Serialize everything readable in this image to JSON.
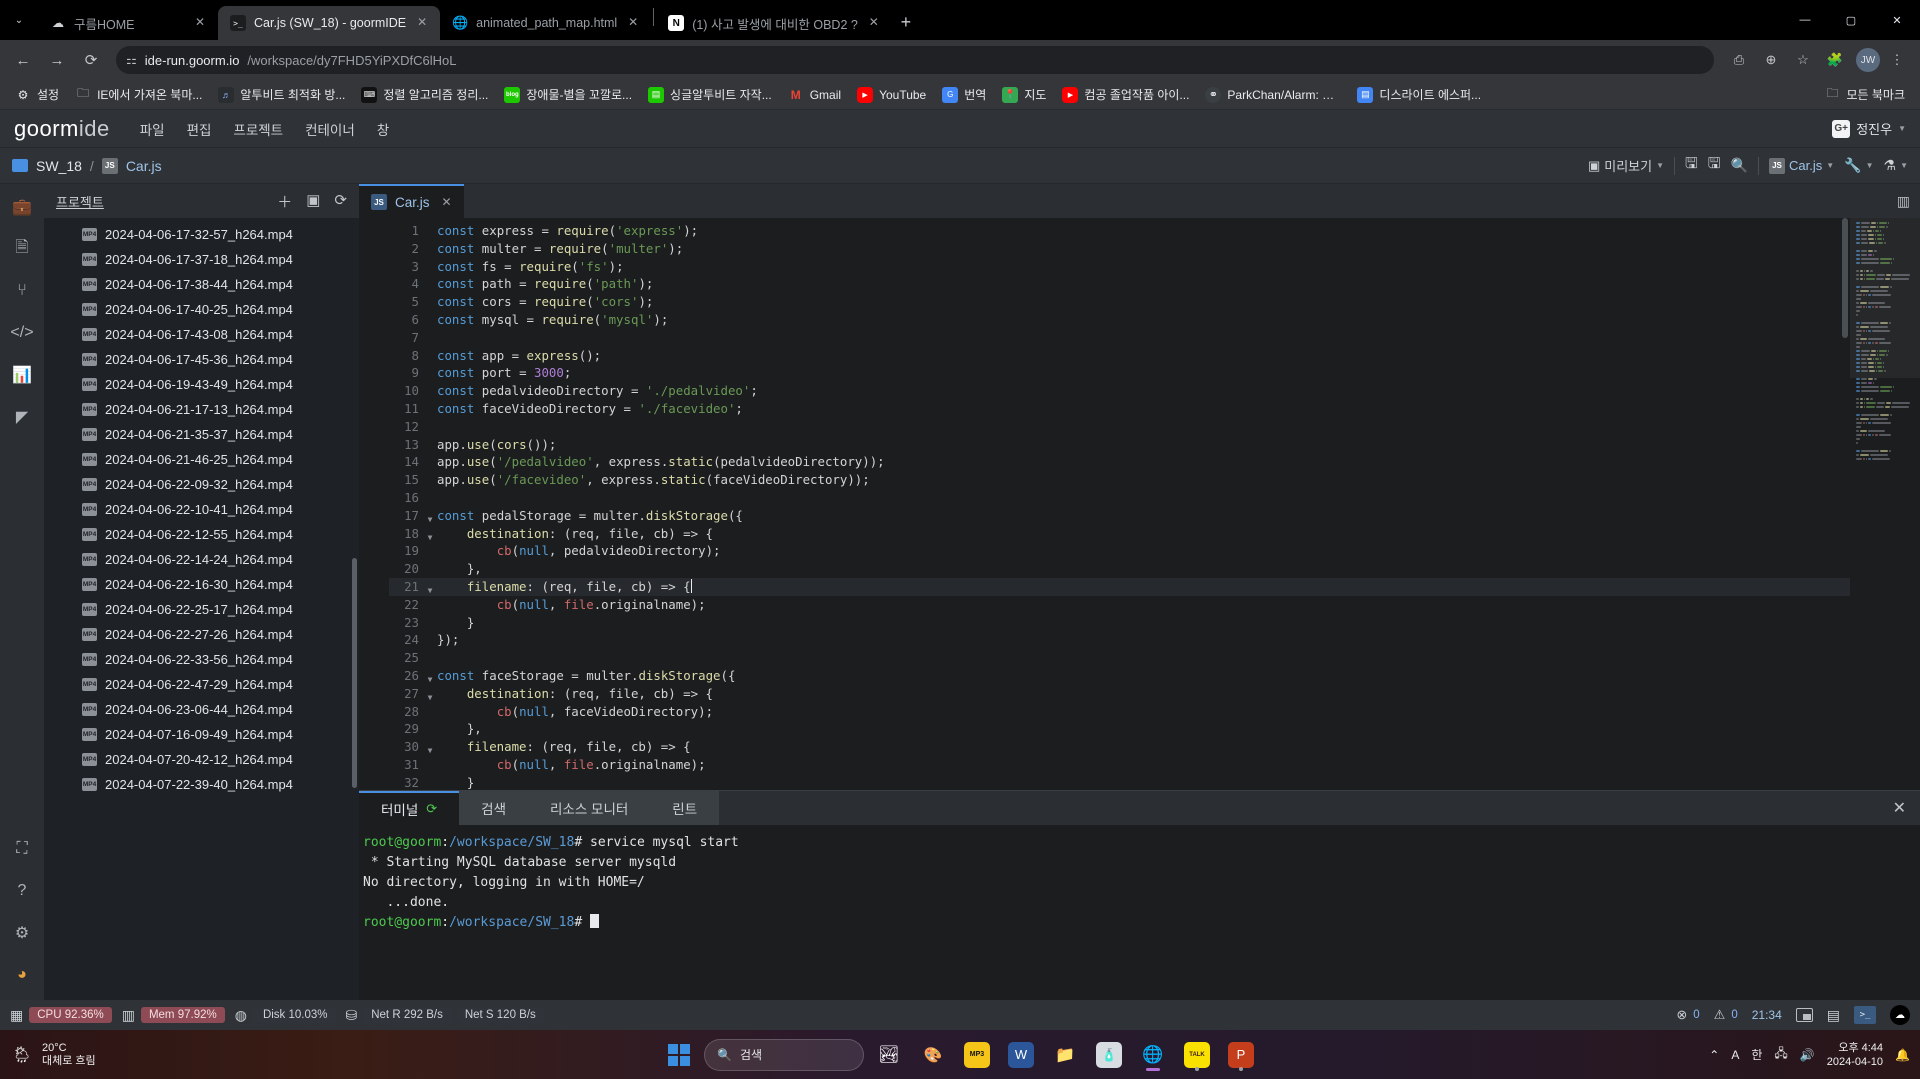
{
  "browser": {
    "tabs": [
      {
        "title": "구름HOME",
        "icon": "cloud-icon",
        "active": false
      },
      {
        "title": "Car.js (SW_18) - goormIDE",
        "icon": "terminal-icon",
        "active": true
      },
      {
        "title": "animated_path_map.html",
        "icon": "globe-icon",
        "active": false
      },
      {
        "title": "(1) 사고 발생에 대비한 OBD2 ?",
        "icon": "notion-icon",
        "active": false
      }
    ],
    "new_tab_label": "+",
    "nav": {
      "back": "←",
      "forward": "→",
      "reload": "⟳"
    },
    "address": {
      "host": "ide-run.goorm.io",
      "path": "/workspace/dy7FHD5YiPXDfC6lHoL"
    },
    "window_controls": {
      "minimize": "—",
      "maximize": "▢",
      "close": "✕"
    },
    "bookmarks": [
      {
        "label": "설정",
        "icon": "gear-icon"
      },
      {
        "label": "IE에서 가져온 북마...",
        "icon": "folder-icon"
      },
      {
        "label": "알투비트 최적화 방...",
        "icon": "music-icon"
      },
      {
        "label": "정렬 알고리즘 정리...",
        "icon": "keyboard-icon"
      },
      {
        "label": "장애물-별을 꼬깔로...",
        "icon": "blog-icon"
      },
      {
        "label": "싱글알투비트 자작...",
        "icon": "naver-icon"
      },
      {
        "label": "Gmail",
        "icon": "gmail-icon"
      },
      {
        "label": "YouTube",
        "icon": "youtube-icon"
      },
      {
        "label": "번역",
        "icon": "translate-icon"
      },
      {
        "label": "지도",
        "icon": "maps-icon"
      },
      {
        "label": "컴공 졸업작품 아이...",
        "icon": "youtube-icon"
      },
      {
        "label": "ParkChan/Alarm: 알...",
        "icon": "github-icon"
      },
      {
        "label": "디스라이트 에스퍼...",
        "icon": "doc-icon"
      }
    ],
    "all_bookmarks_label": "모든 북마크"
  },
  "ide": {
    "logo_bold": "goorm",
    "logo_dim": "ide",
    "menu": [
      "파일",
      "편집",
      "프로젝트",
      "컨테이너",
      "창"
    ],
    "user": "정진우",
    "breadcrumb": {
      "workspace": "SW_18",
      "separator": "/",
      "file": "Car.js",
      "file_badge": "JS"
    },
    "toolbar": {
      "preview_label": "미리보기",
      "save_title": "저장",
      "save_all_title": "모두 저장",
      "search_title": "검색",
      "run_target": "Car.js",
      "run_badge": "JS",
      "wrench_title": "설정",
      "flask_title": "테스트",
      "layout_title": "레이아웃"
    },
    "activity_icons": [
      "briefcase-icon",
      "document-icon",
      "git-branch-icon",
      "code-icon",
      "chart-icon",
      "extensions-icon"
    ],
    "activity_bottom_icons": [
      "fullscreen-icon",
      "help-icon",
      "settings-icon",
      "user-icon"
    ],
    "panel": {
      "title": "프로젝트",
      "actions": [
        "plus-icon",
        "collapse-icon",
        "refresh-icon"
      ],
      "files": [
        "2024-04-06-17-32-57_h264.mp4",
        "2024-04-06-17-37-18_h264.mp4",
        "2024-04-06-17-38-44_h264.mp4",
        "2024-04-06-17-40-25_h264.mp4",
        "2024-04-06-17-43-08_h264.mp4",
        "2024-04-06-17-45-36_h264.mp4",
        "2024-04-06-19-43-49_h264.mp4",
        "2024-04-06-21-17-13_h264.mp4",
        "2024-04-06-21-35-37_h264.mp4",
        "2024-04-06-21-46-25_h264.mp4",
        "2024-04-06-22-09-32_h264.mp4",
        "2024-04-06-22-10-41_h264.mp4",
        "2024-04-06-22-12-55_h264.mp4",
        "2024-04-06-22-14-24_h264.mp4",
        "2024-04-06-22-16-30_h264.mp4",
        "2024-04-06-22-25-17_h264.mp4",
        "2024-04-06-22-27-26_h264.mp4",
        "2024-04-06-22-33-56_h264.mp4",
        "2024-04-06-22-47-29_h264.mp4",
        "2024-04-06-23-06-44_h264.mp4",
        "2024-04-07-16-09-49_h264.mp4",
        "2024-04-07-20-42-12_h264.mp4",
        "2024-04-07-22-39-40_h264.mp4"
      ],
      "file_badge": "MP4"
    },
    "editor": {
      "tab": {
        "badge": "JS",
        "name": "Car.js",
        "close": "✕"
      },
      "cursor_line": 21,
      "lines": [
        {
          "n": 1,
          "fold": false,
          "tokens": [
            [
              "kw",
              "const"
            ],
            [
              "plain",
              " express = "
            ],
            [
              "fn",
              "require"
            ],
            [
              "plain",
              "("
            ],
            [
              "str",
              "'express'"
            ],
            [
              "plain",
              ");"
            ]
          ]
        },
        {
          "n": 2,
          "fold": false,
          "tokens": [
            [
              "kw",
              "const"
            ],
            [
              "plain",
              " multer = "
            ],
            [
              "fn",
              "require"
            ],
            [
              "plain",
              "("
            ],
            [
              "str",
              "'multer'"
            ],
            [
              "plain",
              ");"
            ]
          ]
        },
        {
          "n": 3,
          "fold": false,
          "tokens": [
            [
              "kw",
              "const"
            ],
            [
              "plain",
              " fs = "
            ],
            [
              "fn",
              "require"
            ],
            [
              "plain",
              "("
            ],
            [
              "str",
              "'fs'"
            ],
            [
              "plain",
              ");"
            ]
          ]
        },
        {
          "n": 4,
          "fold": false,
          "tokens": [
            [
              "kw",
              "const"
            ],
            [
              "plain",
              " path = "
            ],
            [
              "fn",
              "require"
            ],
            [
              "plain",
              "("
            ],
            [
              "str",
              "'path'"
            ],
            [
              "plain",
              ");"
            ]
          ]
        },
        {
          "n": 5,
          "fold": false,
          "tokens": [
            [
              "kw",
              "const"
            ],
            [
              "plain",
              " cors = "
            ],
            [
              "fn",
              "require"
            ],
            [
              "plain",
              "("
            ],
            [
              "str",
              "'cors'"
            ],
            [
              "plain",
              ");"
            ]
          ]
        },
        {
          "n": 6,
          "fold": false,
          "tokens": [
            [
              "kw",
              "const"
            ],
            [
              "plain",
              " mysql = "
            ],
            [
              "fn",
              "require"
            ],
            [
              "plain",
              "("
            ],
            [
              "str",
              "'mysql'"
            ],
            [
              "plain",
              ");"
            ]
          ]
        },
        {
          "n": 7,
          "fold": false,
          "tokens": []
        },
        {
          "n": 8,
          "fold": false,
          "tokens": [
            [
              "kw",
              "const"
            ],
            [
              "plain",
              " app = "
            ],
            [
              "fn",
              "express"
            ],
            [
              "plain",
              "();"
            ]
          ]
        },
        {
          "n": 9,
          "fold": false,
          "tokens": [
            [
              "kw",
              "const"
            ],
            [
              "plain",
              " port = "
            ],
            [
              "num",
              "3000"
            ],
            [
              "plain",
              ";"
            ]
          ]
        },
        {
          "n": 10,
          "fold": false,
          "tokens": [
            [
              "kw",
              "const"
            ],
            [
              "plain",
              " pedalvideoDirectory = "
            ],
            [
              "str",
              "'./pedalvideo'"
            ],
            [
              "plain",
              ";"
            ]
          ]
        },
        {
          "n": 11,
          "fold": false,
          "tokens": [
            [
              "kw",
              "const"
            ],
            [
              "plain",
              " faceVideoDirectory = "
            ],
            [
              "str",
              "'./facevideo'"
            ],
            [
              "plain",
              ";"
            ]
          ]
        },
        {
          "n": 12,
          "fold": false,
          "tokens": []
        },
        {
          "n": 13,
          "fold": false,
          "tokens": [
            [
              "plain",
              "app."
            ],
            [
              "fn",
              "use"
            ],
            [
              "plain",
              "("
            ],
            [
              "fn",
              "cors"
            ],
            [
              "plain",
              "());"
            ]
          ]
        },
        {
          "n": 14,
          "fold": false,
          "tokens": [
            [
              "plain",
              "app."
            ],
            [
              "fn",
              "use"
            ],
            [
              "plain",
              "("
            ],
            [
              "str",
              "'/pedalvideo'"
            ],
            [
              "plain",
              ", express."
            ],
            [
              "fn",
              "static"
            ],
            [
              "plain",
              "(pedalvideoDirectory));"
            ]
          ]
        },
        {
          "n": 15,
          "fold": false,
          "tokens": [
            [
              "plain",
              "app."
            ],
            [
              "fn",
              "use"
            ],
            [
              "plain",
              "("
            ],
            [
              "str",
              "'/facevideo'"
            ],
            [
              "plain",
              ", express."
            ],
            [
              "fn",
              "static"
            ],
            [
              "plain",
              "(faceVideoDirectory));"
            ]
          ]
        },
        {
          "n": 16,
          "fold": false,
          "tokens": []
        },
        {
          "n": 17,
          "fold": true,
          "tokens": [
            [
              "kw",
              "const"
            ],
            [
              "plain",
              " pedalStorage = multer."
            ],
            [
              "fn",
              "diskStorage"
            ],
            [
              "plain",
              "({"
            ]
          ]
        },
        {
          "n": 18,
          "fold": true,
          "tokens": [
            [
              "plain",
              "    "
            ],
            [
              "prop",
              "destination"
            ],
            [
              "plain",
              ": (req, file, cb) => {"
            ]
          ]
        },
        {
          "n": 19,
          "fold": false,
          "tokens": [
            [
              "plain",
              "        "
            ],
            [
              "red",
              "cb"
            ],
            [
              "plain",
              "("
            ],
            [
              "kw",
              "null"
            ],
            [
              "plain",
              ", pedalvideoDirectory);"
            ]
          ]
        },
        {
          "n": 20,
          "fold": false,
          "tokens": [
            [
              "plain",
              "    },"
            ]
          ]
        },
        {
          "n": 21,
          "fold": true,
          "tokens": [
            [
              "plain",
              "    "
            ],
            [
              "prop",
              "filename"
            ],
            [
              "plain",
              ": (req, file, cb) => {"
            ]
          ],
          "cursor": true
        },
        {
          "n": 22,
          "fold": false,
          "tokens": [
            [
              "plain",
              "        "
            ],
            [
              "red",
              "cb"
            ],
            [
              "plain",
              "("
            ],
            [
              "kw",
              "null"
            ],
            [
              "plain",
              ", "
            ],
            [
              "red",
              "file"
            ],
            [
              "plain",
              ".originalname);"
            ]
          ]
        },
        {
          "n": 23,
          "fold": false,
          "tokens": [
            [
              "plain",
              "    }"
            ]
          ]
        },
        {
          "n": 24,
          "fold": false,
          "tokens": [
            [
              "plain",
              "});"
            ]
          ]
        },
        {
          "n": 25,
          "fold": false,
          "tokens": []
        },
        {
          "n": 26,
          "fold": true,
          "tokens": [
            [
              "kw",
              "const"
            ],
            [
              "plain",
              " faceStorage = multer."
            ],
            [
              "fn",
              "diskStorage"
            ],
            [
              "plain",
              "({"
            ]
          ]
        },
        {
          "n": 27,
          "fold": true,
          "tokens": [
            [
              "plain",
              "    "
            ],
            [
              "prop",
              "destination"
            ],
            [
              "plain",
              ": (req, file, cb) => {"
            ]
          ]
        },
        {
          "n": 28,
          "fold": false,
          "tokens": [
            [
              "plain",
              "        "
            ],
            [
              "red",
              "cb"
            ],
            [
              "plain",
              "("
            ],
            [
              "kw",
              "null"
            ],
            [
              "plain",
              ", faceVideoDirectory);"
            ]
          ]
        },
        {
          "n": 29,
          "fold": false,
          "tokens": [
            [
              "plain",
              "    },"
            ]
          ]
        },
        {
          "n": 30,
          "fold": true,
          "tokens": [
            [
              "plain",
              "    "
            ],
            [
              "prop",
              "filename"
            ],
            [
              "plain",
              ": (req, file, cb) => {"
            ]
          ]
        },
        {
          "n": 31,
          "fold": false,
          "tokens": [
            [
              "plain",
              "        "
            ],
            [
              "red",
              "cb"
            ],
            [
              "plain",
              "("
            ],
            [
              "kw",
              "null"
            ],
            [
              "plain",
              ", "
            ],
            [
              "red",
              "file"
            ],
            [
              "plain",
              ".originalname);"
            ]
          ]
        },
        {
          "n": 32,
          "fold": false,
          "tokens": [
            [
              "plain",
              "    }"
            ]
          ]
        }
      ]
    },
    "bottom": {
      "tabs": [
        {
          "label": "터미널",
          "icon": "sync-icon",
          "active": true
        },
        {
          "label": "검색",
          "icon": "",
          "active": false
        },
        {
          "label": "리소스 모니터",
          "icon": "",
          "active": false
        },
        {
          "label": "린트",
          "icon": "",
          "active": false
        }
      ],
      "close_label": "✕",
      "terminal": [
        {
          "parts": [
            [
              "user",
              "root@goorm"
            ],
            [
              "plain",
              ":"
            ],
            [
              "path",
              "/workspace/SW_18"
            ],
            [
              "plain",
              "# service mysql start"
            ]
          ]
        },
        {
          "parts": [
            [
              "plain",
              " * Starting MySQL database server mysqld"
            ]
          ]
        },
        {
          "parts": [
            [
              "plain",
              "No directory, logging in with HOME=/"
            ]
          ]
        },
        {
          "parts": [
            [
              "plain",
              "   ...done."
            ]
          ]
        },
        {
          "parts": [
            [
              "user",
              "root@goorm"
            ],
            [
              "plain",
              ":"
            ],
            [
              "path",
              "/workspace/SW_18"
            ],
            [
              "plain",
              "# "
            ]
          ],
          "cursor": true
        }
      ]
    },
    "status": {
      "cpu": "CPU 92.36%",
      "mem": "Mem 97.92%",
      "disk": "Disk 10.03%",
      "net_r": "Net R 292 B/s",
      "net_s": "Net S 120 B/s",
      "errors": "0",
      "warnings": "0",
      "time": "21:34",
      "icons": [
        "panel-icon",
        "chat-icon",
        "terminal-icon",
        "cloud-icon"
      ]
    }
  },
  "taskbar": {
    "weather": {
      "temp": "20°C",
      "desc": "대체로 흐림"
    },
    "search_placeholder": "검색",
    "apps": [
      {
        "name": "widgets-icon",
        "glyph": "",
        "bg": "transparent",
        "state": "none"
      },
      {
        "name": "paint-icon",
        "glyph": "🎨",
        "bg": "transparent",
        "state": "none"
      },
      {
        "name": "mp3-icon",
        "glyph": "MP3",
        "bg": "#f5c518",
        "state": "none"
      },
      {
        "name": "word-icon",
        "glyph": "W",
        "bg": "#2b579a",
        "state": "none"
      },
      {
        "name": "explorer-icon",
        "glyph": "📁",
        "bg": "transparent",
        "state": "none"
      },
      {
        "name": "app-icon",
        "glyph": "",
        "bg": "transparent",
        "state": "none"
      },
      {
        "name": "chrome-icon",
        "glyph": "",
        "bg": "transparent",
        "state": "running"
      },
      {
        "name": "kakaotalk-icon",
        "glyph": "TALK",
        "bg": "#fae100",
        "state": "dot"
      },
      {
        "name": "powerpoint-icon",
        "glyph": "P",
        "bg": "#c43e1c",
        "state": "dot"
      }
    ],
    "tray": {
      "overflow": "⌃",
      "ime_a": "A",
      "ime_ko": "한",
      "network": "network-icon",
      "volume": "volume-icon",
      "notify": "notify-icon"
    },
    "clock": {
      "time": "오후 4:44",
      "date": "2024-04-10"
    }
  }
}
